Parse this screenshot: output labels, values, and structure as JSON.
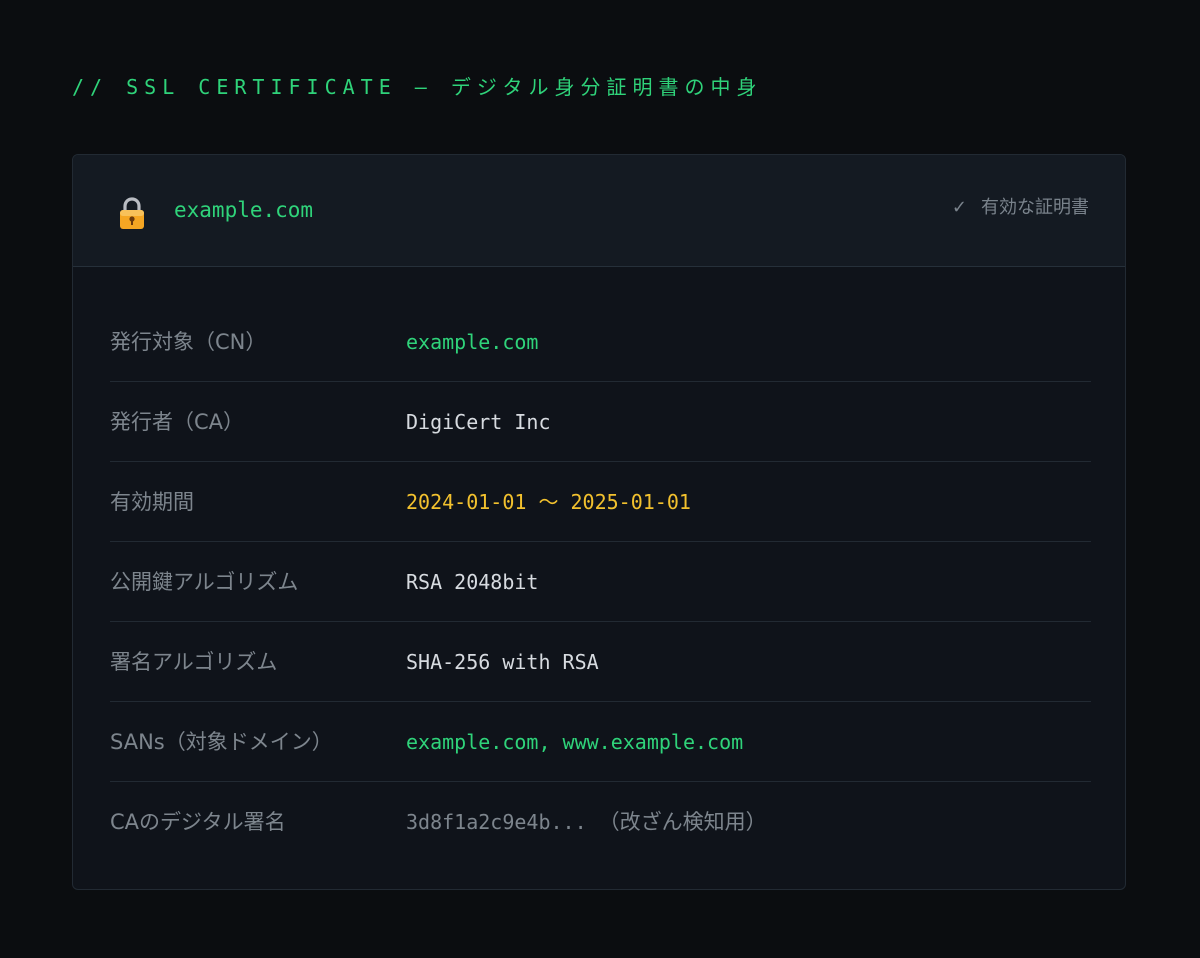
{
  "section_title": "// SSL CERTIFICATE — デジタル身分証明書の中身",
  "certificate": {
    "domain": "example.com",
    "lock_icon": "lock-icon",
    "status_check_icon": "check-icon",
    "status_label": "有効な証明書",
    "colors": {
      "accent_green": "#2fd37a",
      "accent_yellow": "#f2c12e",
      "muted": "#7d858d",
      "background": "#0b0d10",
      "card": "#0f131a"
    },
    "rows": [
      {
        "label": "発行対象（CN）",
        "value": "example.com",
        "tone": "green"
      },
      {
        "label": "発行者（CA）",
        "value": "DigiCert Inc",
        "tone": "default"
      },
      {
        "label": "有効期間",
        "value": "2024-01-01 〜 2025-01-01",
        "tone": "yellow"
      },
      {
        "label": "公開鍵アルゴリズム",
        "value": "RSA 2048bit",
        "tone": "default"
      },
      {
        "label": "署名アルゴリズム",
        "value": "SHA-256 with RSA",
        "tone": "default"
      },
      {
        "label": "SANs（対象ドメイン）",
        "value": "example.com, www.example.com",
        "tone": "green"
      },
      {
        "label": "CAのデジタル署名",
        "value": "3d8f1a2c9e4b...",
        "note": "（改ざん検知用）",
        "tone": "muted"
      }
    ]
  }
}
